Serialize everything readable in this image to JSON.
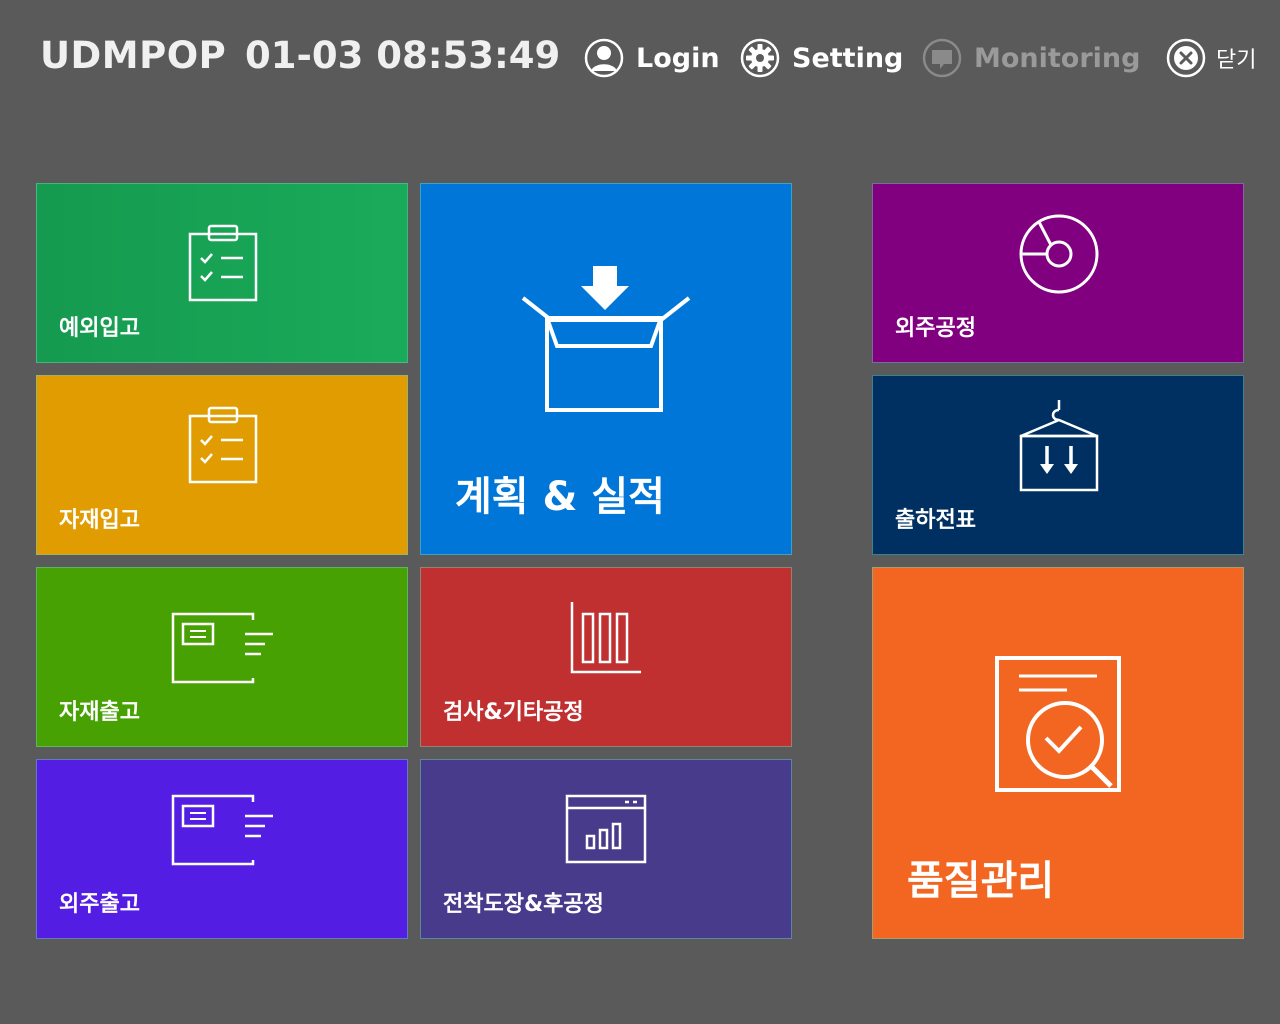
{
  "header": {
    "app_title": "UDMPOP",
    "clock": "01-03 08:53:49",
    "nav": {
      "login": "Login",
      "setting": "Setting",
      "monitoring": "Monitoring",
      "close": "닫기"
    }
  },
  "tiles": {
    "exception_receipt": {
      "label": "예외입고",
      "color": "#1aa154",
      "icon": "clipboard-check-icon"
    },
    "material_receipt": {
      "label": "자재입고",
      "color": "#e09c00",
      "icon": "clipboard-check-icon"
    },
    "material_issue": {
      "label": "자재출고",
      "color": "#47a102",
      "icon": "card-send-icon"
    },
    "outsourcing_issue": {
      "label": "외주출고",
      "color": "#531de3",
      "icon": "card-send-icon"
    },
    "plan_performance": {
      "label": "계획 & 실적",
      "color": "#0077d8",
      "icon": "box-download-icon"
    },
    "inspection_process": {
      "label": "검사&기타공정",
      "color": "#c03030",
      "icon": "bar-chart-icon"
    },
    "electrodeposition_process": {
      "label": "전착도장&후공정",
      "color": "#493b8c",
      "icon": "window-chart-icon"
    },
    "outsourcing_process": {
      "label": "외주공정",
      "color": "#810080",
      "icon": "pie-chart-icon"
    },
    "shipping_slip": {
      "label": "출하전표",
      "color": "#003062",
      "icon": "crane-box-icon"
    },
    "quality_management": {
      "label": "품질관리",
      "color": "#f36622",
      "icon": "document-search-icon"
    }
  }
}
